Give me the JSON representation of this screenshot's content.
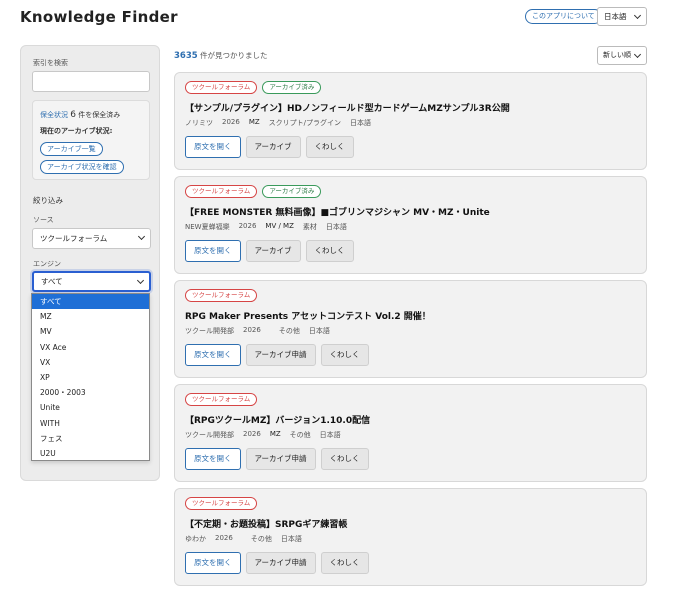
{
  "header": {
    "title": "Knowledge Finder",
    "about_label": "このアプリについて",
    "language": "日本語"
  },
  "sidebar": {
    "search_label": "索引を検索",
    "search_value": "",
    "archive": {
      "status_link": "保全状況",
      "status_count": "6",
      "status_suffix": "件を保全済み",
      "current_label": "現在のアーカイブ状況:",
      "list_button": "アーカイブ一覧",
      "check_button": "アーカイブ状況を確認"
    },
    "filter_title": "絞り込み",
    "source_label": "ソース",
    "source_value": "ツクールフォーラム",
    "engine_label": "エンジン",
    "engine_value": "すべて",
    "engine_options": [
      "すべて",
      "MZ",
      "MV",
      "VX Ace",
      "VX",
      "XP",
      "2000・2003",
      "Unite",
      "WITH",
      "フェス",
      "U2U"
    ]
  },
  "results": {
    "count": "3635",
    "count_suffix": "件が見つかりました",
    "sort": "新しい順"
  },
  "cards": [
    {
      "badges": [
        "ツクールフォーラム",
        "アーカイブ済み"
      ],
      "title": "【サンプル/プラグイン】HDノンフィールド型カードゲームMZサンプル3R公開",
      "meta": [
        "ノリミツ",
        "2026",
        "MZ",
        "スクリプト/プラグイン",
        "日本語"
      ],
      "actions": [
        "原文を開く",
        "アーカイブ",
        "くわしく"
      ]
    },
    {
      "badges": [
        "ツクールフォーラム",
        "アーカイブ済み"
      ],
      "title": "【FREE MONSTER 無料画像】■ゴブリンマジシャン MV・MZ・Unite",
      "meta": [
        "NEW夏蝉福樂",
        "2026",
        "MV / MZ",
        "素材",
        "日本語"
      ],
      "actions": [
        "原文を開く",
        "アーカイブ",
        "くわしく"
      ]
    },
    {
      "badges": [
        "ツクールフォーラム"
      ],
      "title": "RPG Maker Presents アセットコンテスト Vol.2 開催！",
      "meta": [
        "ツクール開発部",
        "2026",
        "",
        "その他",
        "日本語"
      ],
      "actions": [
        "原文を開く",
        "アーカイブ申請",
        "くわしく"
      ]
    },
    {
      "badges": [
        "ツクールフォーラム"
      ],
      "title": "【RPGツクールMZ】バージョン1.10.0配信",
      "meta": [
        "ツクール開発部",
        "2026",
        "MZ",
        "その他",
        "日本語"
      ],
      "actions": [
        "原文を開く",
        "アーカイブ申請",
        "くわしく"
      ]
    },
    {
      "badges": [
        "ツクールフォーラム"
      ],
      "title": "【不定期・お題投稿】SRPGギア練習帳",
      "meta": [
        "ゆわか",
        "2026",
        "",
        "その他",
        "日本語"
      ],
      "actions": [
        "原文を開く",
        "アーカイブ申請",
        "くわしく"
      ]
    }
  ]
}
